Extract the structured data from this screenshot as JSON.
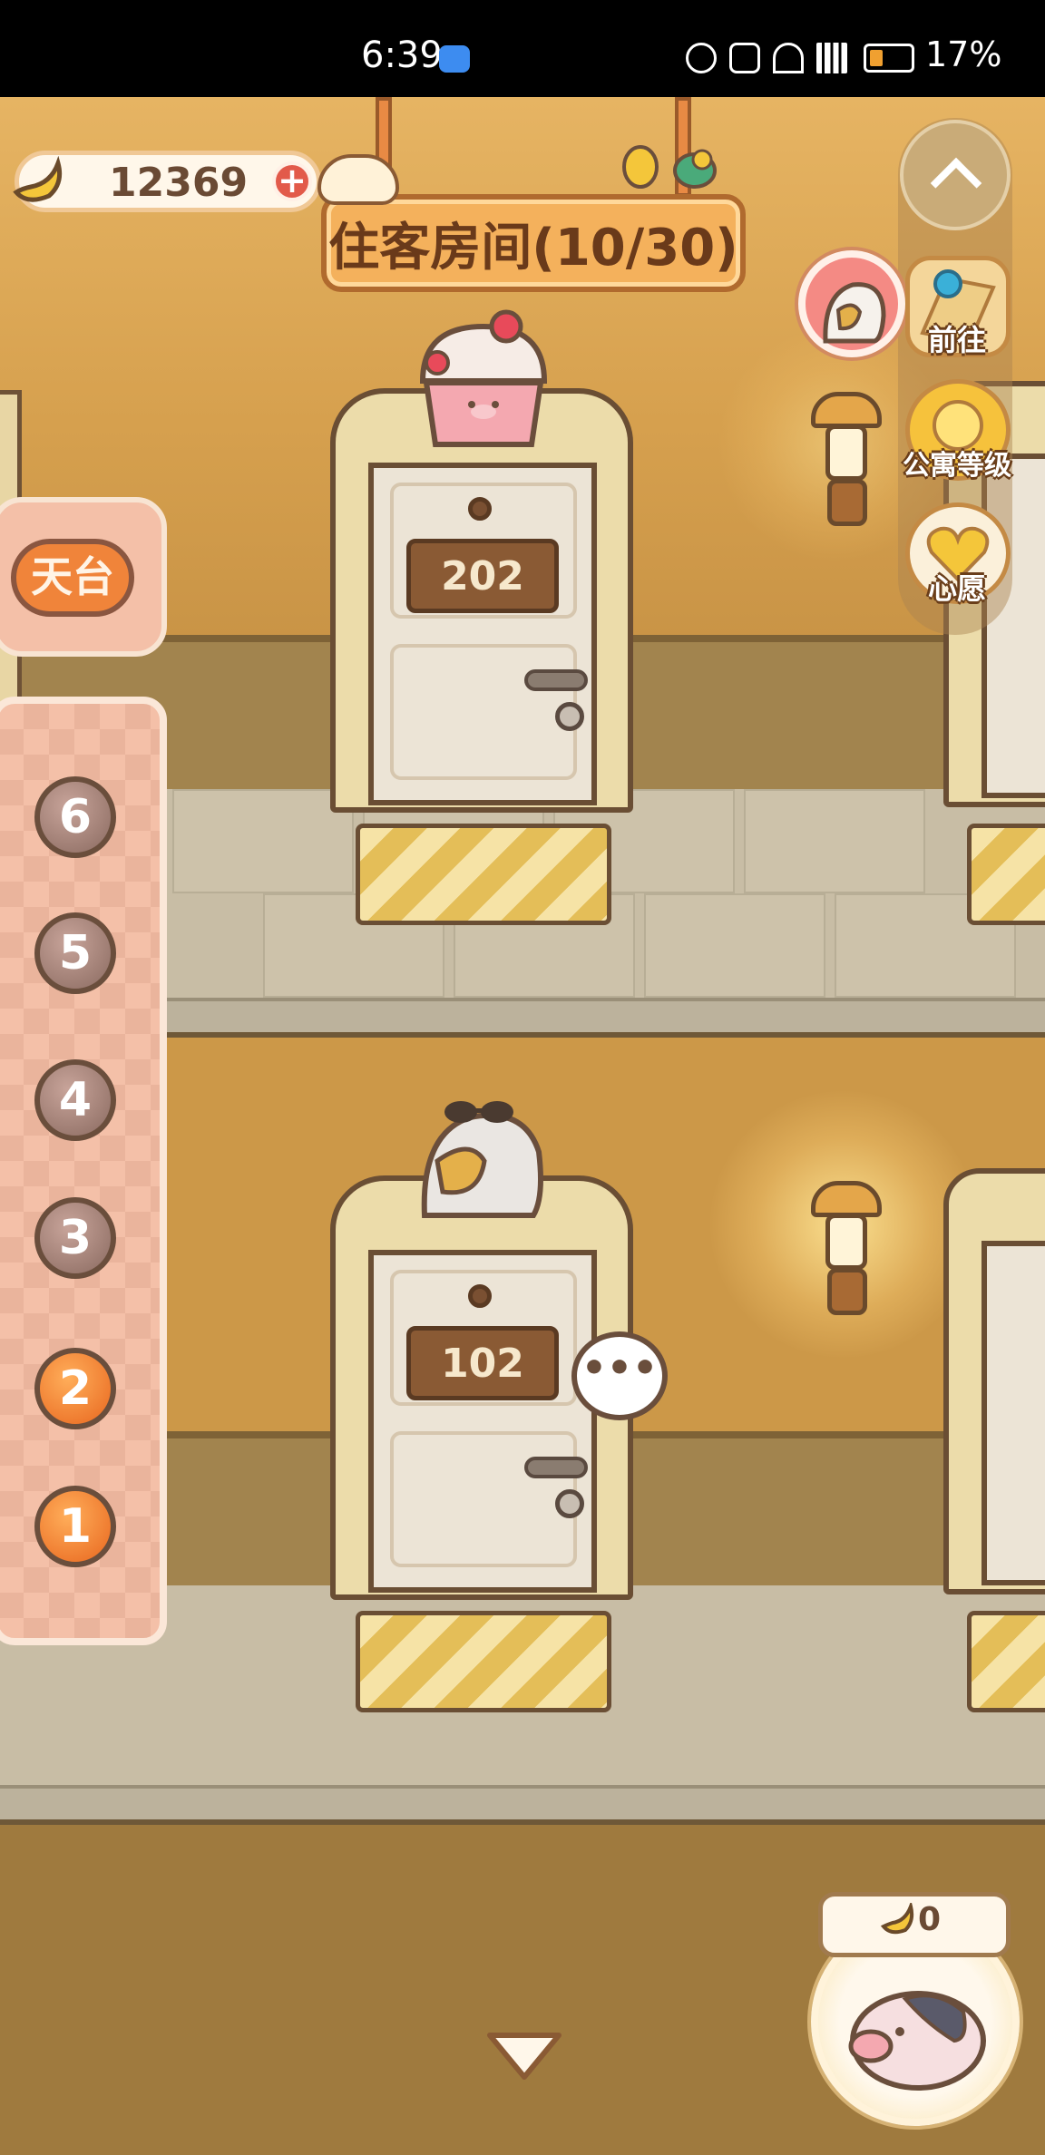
{
  "status_bar": {
    "time": "6:39",
    "battery": "17%"
  },
  "currency": {
    "value": "12369",
    "icon": "banana-icon",
    "add_icon": "plus-icon"
  },
  "room_title": "住客房间(10/30)",
  "floor_selector": {
    "roof_label": "天台",
    "floors": [
      "6",
      "5",
      "4",
      "3",
      "2",
      "1"
    ],
    "active_floors": [
      "2",
      "1"
    ]
  },
  "side_menu": {
    "collapse_icon": "chevron-up-icon",
    "guest_icon": "parrot-guest-icon",
    "items": [
      {
        "label": "前往",
        "icon": "map-pin-icon"
      },
      {
        "label": "公寓等级",
        "icon": "sun-badge-icon"
      },
      {
        "label": "心愿",
        "icon": "heart-book-icon"
      }
    ]
  },
  "rooms": [
    {
      "number": "202",
      "decor": "cupcake-hat"
    },
    {
      "number": "102",
      "decor": "parrot-with-sunglasses"
    }
  ],
  "chat_bubble": "•••",
  "piggy_bank": {
    "value": "0",
    "icon": "banana-icon"
  },
  "colors": {
    "accent_orange": "#f0843a",
    "wall": "#d6a04e",
    "panel_pink": "#f4c0a8",
    "wood": "#8a5a34"
  }
}
